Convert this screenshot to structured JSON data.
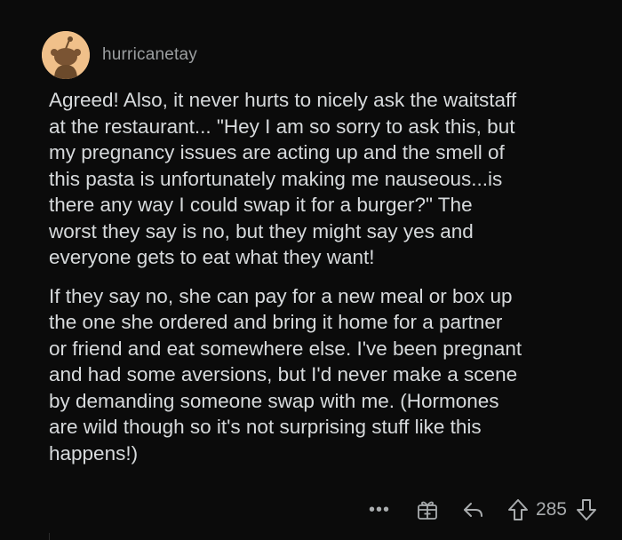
{
  "comment": {
    "username": "hurricanetay",
    "paragraphs": [
      "Agreed! Also, it never hurts to nicely ask the waitstaff\nat the restaurant... \"Hey I am so sorry to ask this, but\nmy pregnancy issues are acting up and the smell of\nthis pasta is unfortunately making me nauseous...is\nthere any way I could swap it for a burger?\" The\nworst they say is no, but they might say yes and\neveryone gets to eat what they want!",
      "If they say no, she can pay for a new meal or box up\nthe one she ordered and bring it home for a partner\nor friend and eat somewhere else. I've been pregnant\nand had some aversions, but I'd never make a scene\nby demanding someone swap with me. (Hormones\nare wild though so it's not surprising stuff like this\nhappens!)"
    ]
  },
  "actions": {
    "more_label": "•••",
    "score": "285",
    "icons": {
      "more": "more-icon",
      "award": "award-icon",
      "reply": "reply-icon",
      "upvote": "upvote-icon",
      "downvote": "downvote-icon"
    }
  },
  "colors": {
    "background": "#0b0b0b",
    "text": "#d7dadc",
    "username": "#9b9ea0",
    "icon": "#a9acae",
    "avatar_bg": "#f0c08a"
  }
}
